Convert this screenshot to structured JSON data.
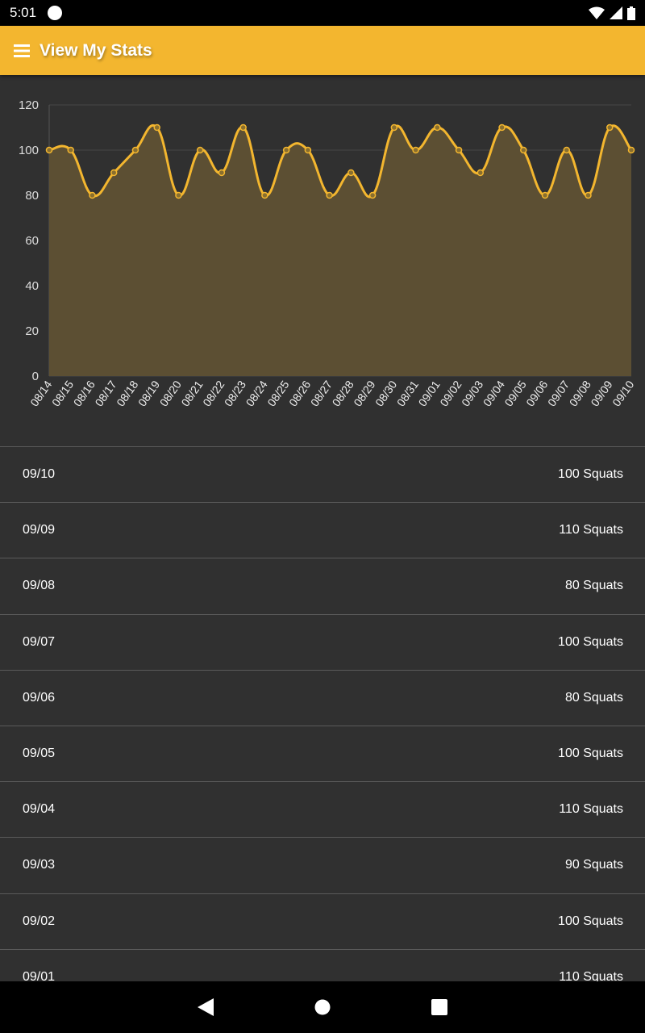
{
  "status_bar": {
    "time": "5:01"
  },
  "app_bar": {
    "title": "View My Stats",
    "menu_icon": "hamburger-icon"
  },
  "colors": {
    "accent": "#f3b62f",
    "background": "#303030",
    "fill": "#5c4f33"
  },
  "chart_data": {
    "type": "area",
    "categories": [
      "08/14",
      "08/15",
      "08/16",
      "08/17",
      "08/18",
      "08/19",
      "08/20",
      "08/21",
      "08/22",
      "08/23",
      "08/24",
      "08/25",
      "08/26",
      "08/27",
      "08/28",
      "08/29",
      "08/30",
      "08/31",
      "09/01",
      "09/02",
      "09/03",
      "09/04",
      "09/05",
      "09/06",
      "09/07",
      "09/08",
      "09/09",
      "09/10"
    ],
    "values": [
      100,
      100,
      80,
      90,
      100,
      110,
      80,
      100,
      90,
      110,
      80,
      100,
      100,
      80,
      90,
      80,
      110,
      100,
      110,
      100,
      90,
      110,
      100,
      80,
      100,
      80,
      110,
      100
    ],
    "ylim": [
      0,
      120
    ],
    "yticks": [
      0,
      20,
      40,
      60,
      80,
      100,
      120
    ],
    "grid": true,
    "smooth": true
  },
  "list": [
    {
      "date": "09/10",
      "value": "100 Squats"
    },
    {
      "date": "09/09",
      "value": "110 Squats"
    },
    {
      "date": "09/08",
      "value": "80 Squats"
    },
    {
      "date": "09/07",
      "value": "100 Squats"
    },
    {
      "date": "09/06",
      "value": "80 Squats"
    },
    {
      "date": "09/05",
      "value": "100 Squats"
    },
    {
      "date": "09/04",
      "value": "110 Squats"
    },
    {
      "date": "09/03",
      "value": "90 Squats"
    },
    {
      "date": "09/02",
      "value": "100 Squats"
    },
    {
      "date": "09/01",
      "value": "110 Squats"
    }
  ]
}
